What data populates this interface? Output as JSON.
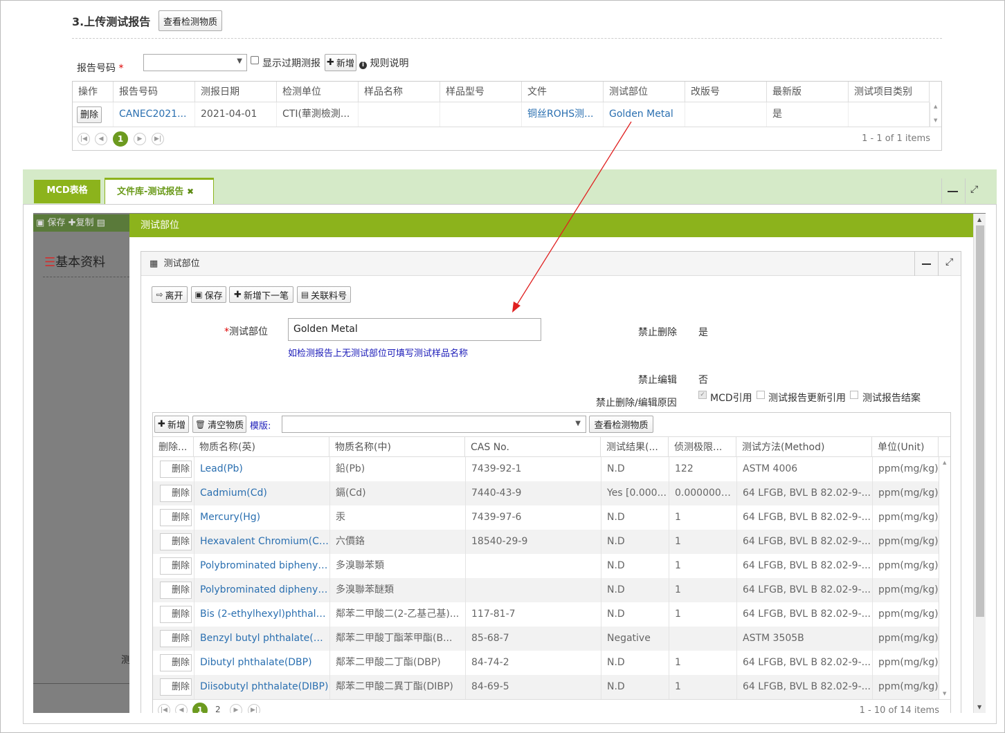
{
  "upload": {
    "title": "3.上传测试报告",
    "view_btn": "查看检测物质",
    "report_no_label": "报告号码",
    "required_mark": "*",
    "show_expired": "显示过期测报",
    "add_btn": "新增",
    "rules_btn": "规则说明",
    "columns": [
      "操作",
      "报告号码",
      "测报日期",
      "检测单位",
      "样品名称",
      "样品型号",
      "文件",
      "测试部位",
      "改版号",
      "最新版",
      "测试项目类别"
    ],
    "row": {
      "del": "删除",
      "report_no": "CANEC2021...",
      "date": "2021-04-01",
      "unit": "CTI(華測檢測...",
      "sample_name": "",
      "sample_model": "",
      "file": "铜丝ROHS测...",
      "part": "Golden Metal",
      "rev": "",
      "latest": "是",
      "category": ""
    },
    "page_current": "1",
    "items_info": "1 - 1 of 1 items"
  },
  "tabs": {
    "mcd": "MCD表格",
    "library": "文件库-测试报告",
    "close": "✖"
  },
  "bg_toolbar": {
    "save": "保存",
    "copy": "复制"
  },
  "bg_section": "基本资料",
  "bg_trunc": "测",
  "dialog": {
    "title": "测试部位",
    "panel_title": "测试部位",
    "toolbar": {
      "leave": "离开",
      "save": "保存",
      "add_next": "新增下一笔",
      "link_part": "关联料号"
    },
    "field_label": "测试部位",
    "required_mark": "*",
    "field_value": "Golden Metal",
    "hint": "如检测报告上无测试部位可填写测试样品名称",
    "no_delete_label": "禁止删除",
    "no_delete_value": "是",
    "no_edit_label": "禁止编辑",
    "no_edit_value": "否",
    "reason_label": "禁止删除/编辑原因",
    "checks": [
      "MCD引用",
      "测试报告更新引用",
      "测试报告结案"
    ],
    "sub_toolbar": {
      "add": "新增",
      "clear": "清空物质",
      "template_label": "模版:",
      "view": "查看检测物质"
    },
    "columns": [
      "删除...",
      "物质名称(英)",
      "物质名称(中)",
      "CAS No.",
      "测试结果(...",
      "侦测极限...",
      "测试方法(Method)",
      "单位(Unit)"
    ],
    "rows": [
      {
        "del": "删除",
        "en": "Lead(Pb)",
        "cn": "鉛(Pb)",
        "cas": "7439-92-1",
        "result": "N.D",
        "limit": "122",
        "method": "ASTM 4006",
        "unit": "ppm(mg/kg)"
      },
      {
        "del": "删除",
        "en": "Cadmium(Cd)",
        "cn": "鎘(Cd)",
        "cas": "7440-43-9",
        "result": "Yes [0.000...",
        "limit": "0.0000000...",
        "method": "64 LFGB, BVL B 82.02-9-...",
        "unit": "ppm(mg/kg)"
      },
      {
        "del": "删除",
        "en": "Mercury(Hg)",
        "cn": "汞",
        "cas": "7439-97-6",
        "result": "N.D",
        "limit": "1",
        "method": "64 LFGB, BVL B 82.02-9-...",
        "unit": "ppm(mg/kg)"
      },
      {
        "del": "删除",
        "en": "Hexavalent Chromium(Cr...",
        "cn": "六價鉻",
        "cas": "18540-29-9",
        "result": "N.D",
        "limit": "1",
        "method": "64 LFGB, BVL B 82.02-9-...",
        "unit": "ppm(mg/kg)"
      },
      {
        "del": "删除",
        "en": "Polybrominated biphenyls...",
        "cn": "多溴聯苯類",
        "cas": "",
        "result": "N.D",
        "limit": "1",
        "method": "64 LFGB, BVL B 82.02-9-...",
        "unit": "ppm(mg/kg)"
      },
      {
        "del": "删除",
        "en": "Polybrominated diphenyl ...",
        "cn": "多溴聯苯醚類",
        "cas": "",
        "result": "N.D",
        "limit": "1",
        "method": "64 LFGB, BVL B 82.02-9-...",
        "unit": "ppm(mg/kg)"
      },
      {
        "del": "删除",
        "en": "Bis (2-ethylhexyl)phthalat...",
        "cn": "鄰苯二甲酸二(2-乙基己基)...",
        "cas": "117-81-7",
        "result": "N.D",
        "limit": "1",
        "method": "64 LFGB, BVL B 82.02-9-...",
        "unit": "ppm(mg/kg)"
      },
      {
        "del": "删除",
        "en": "Benzyl butyl phthalate(BBP)",
        "cn": "鄰苯二甲酸丁酯苯甲酯(B...",
        "cas": "85-68-7",
        "result": "Negative",
        "limit": "",
        "method": "ASTM 3505B",
        "unit": "ppm(mg/kg)"
      },
      {
        "del": "删除",
        "en": "Dibutyl phthalate(DBP)",
        "cn": "鄰苯二甲酸二丁酯(DBP)",
        "cas": "84-74-2",
        "result": "N.D",
        "limit": "1",
        "method": "64 LFGB, BVL B 82.02-9-...",
        "unit": "ppm(mg/kg)"
      },
      {
        "del": "删除",
        "en": "Diisobutyl phthalate(DIBP)",
        "cn": "鄰苯二甲酸二異丁酯(DIBP)",
        "cas": "84-69-5",
        "result": "N.D",
        "limit": "1",
        "method": "64 LFGB, BVL B 82.02-9-...",
        "unit": "ppm(mg/kg)"
      }
    ],
    "pages": [
      "1",
      "2"
    ],
    "items_info": "1 - 10 of 14 items"
  },
  "colors": {
    "green": "#8cb31c",
    "tab_bg": "#d5eac8",
    "annotation": "#e02020",
    "link": "#2a6fb0"
  }
}
